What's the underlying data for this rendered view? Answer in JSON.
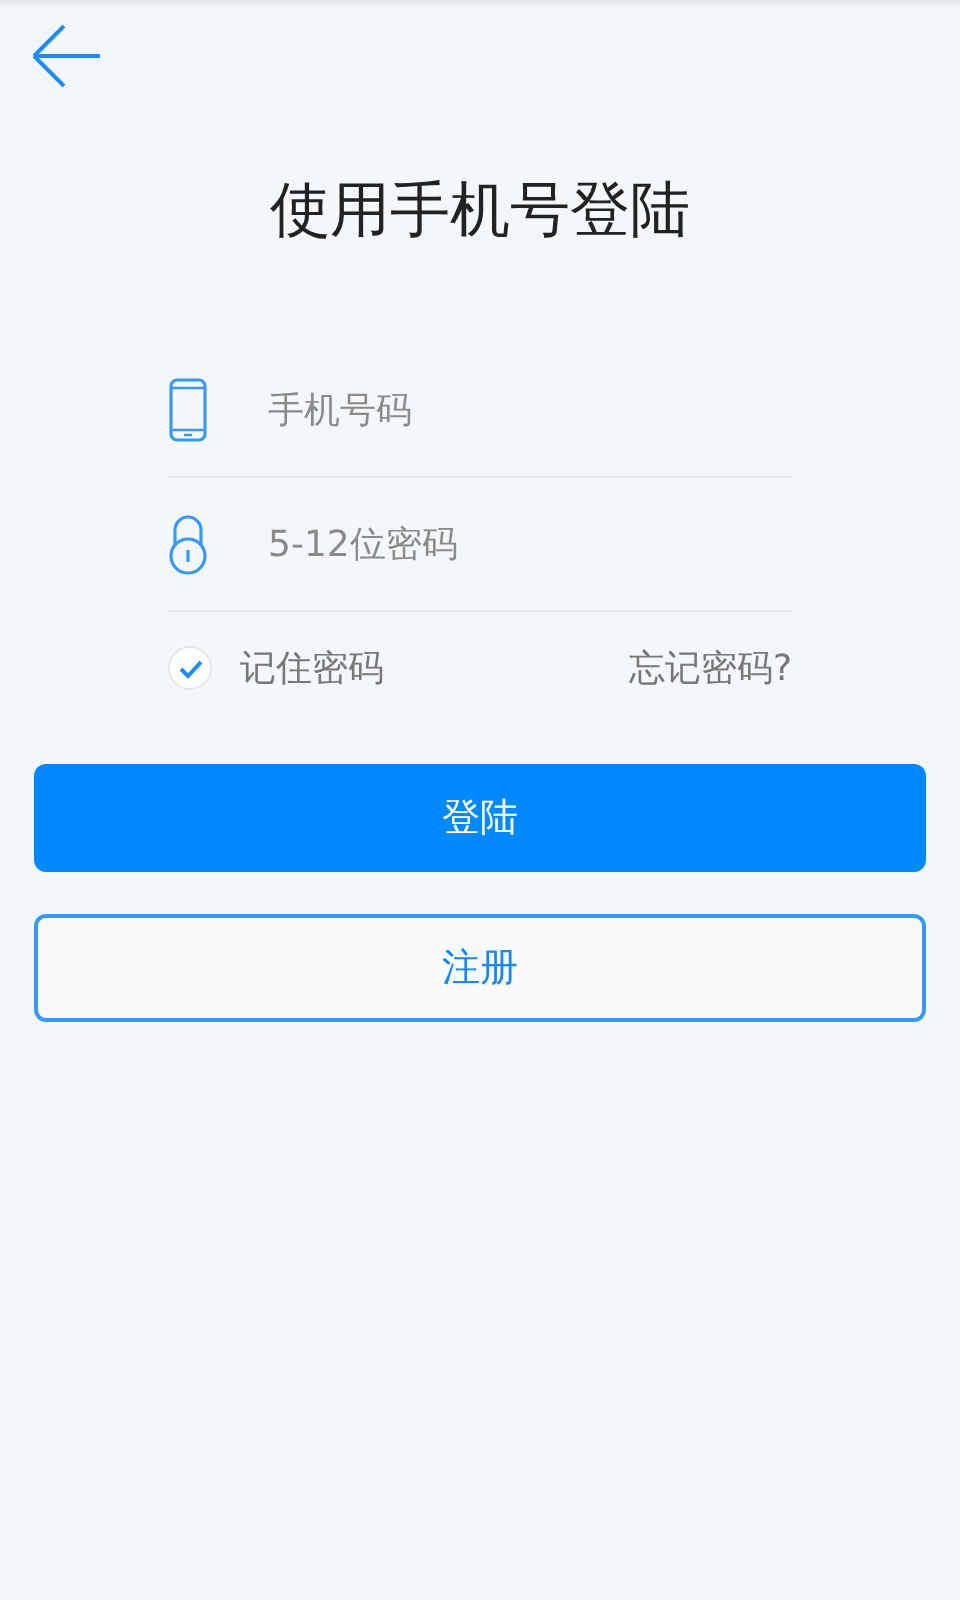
{
  "title": "使用手机号登陆",
  "fields": [
    {
      "kind": "phone",
      "placeholder": "手机号码"
    },
    {
      "kind": "password",
      "placeholder": "5-12位密码"
    }
  ],
  "remember": {
    "label": "记住密码",
    "checked": true
  },
  "forgot_link": "忘记密码?",
  "buttons": [
    {
      "kind": "primary",
      "label": "登陆"
    },
    {
      "kind": "secondary",
      "label": "注册"
    }
  ]
}
